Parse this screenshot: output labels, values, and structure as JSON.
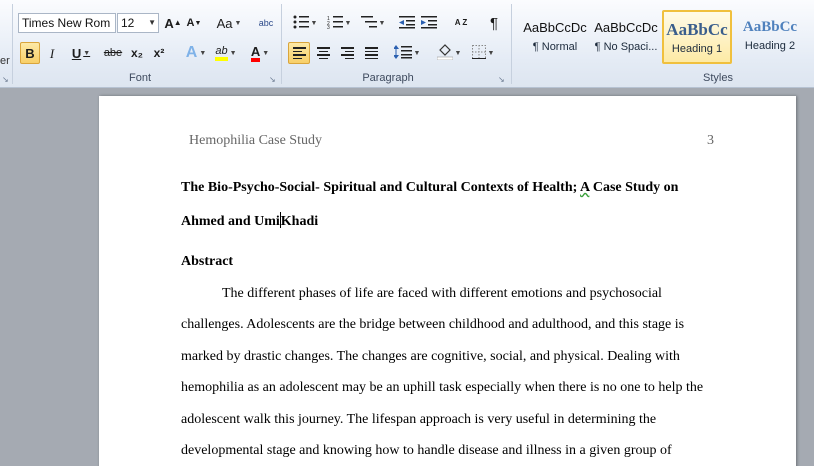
{
  "ribbon": {
    "cut_fragment": "er",
    "font_group": {
      "label": "Font",
      "font_name": "Times New Rom",
      "font_size": "12",
      "grow_font": "A",
      "shrink_font": "A",
      "change_case": "Aa",
      "clear_format": "abc",
      "bold": "B",
      "italic": "I",
      "underline": "U",
      "strikethrough": "abe",
      "subscript": "x₂",
      "superscript": "x²",
      "text_effects": "A",
      "highlight": "ab",
      "font_color": "A",
      "highlight_color": "#ffff00",
      "font_color_value": "#ff0000"
    },
    "paragraph_group": {
      "label": "Paragraph",
      "sort": "A Z",
      "pilcrow": "¶"
    },
    "styles_group": {
      "label": "Styles",
      "items": [
        {
          "sample": "AaBbCcDc",
          "name": "¶ Normal"
        },
        {
          "sample": "AaBbCcDc",
          "name": "¶ No Spaci..."
        },
        {
          "sample": "AaBbCc",
          "name": "Heading 1"
        },
        {
          "sample": "AaBbCc",
          "name": "Heading 2"
        }
      ]
    }
  },
  "document": {
    "header_title": "Hemophilia Case Study",
    "page_number": "3",
    "title_line1_before": "The Bio-Psycho-Social- Spiritual and Cultural Contexts of Health; ",
    "title_line1_flagged": "A",
    "title_line1_after": " Case Study on",
    "title_line2_before_caret": "Ahmed and Umi",
    "title_line2_after_caret": "Khadi",
    "abstract_heading": "Abstract",
    "body_lines": [
      "The different phases of life are faced with different emotions and psychosocial",
      "challenges. Adolescents are the bridge between childhood and adulthood, and this stage is",
      "marked by drastic changes. The changes are cognitive, social, and physical. Dealing with",
      "hemophilia as an adolescent may be an uphill task especially when there is no one to help the",
      "adolescent walk this journey. The lifespan approach is very useful in determining the",
      "developmental stage and knowing how to handle disease and illness in a given group of"
    ]
  }
}
